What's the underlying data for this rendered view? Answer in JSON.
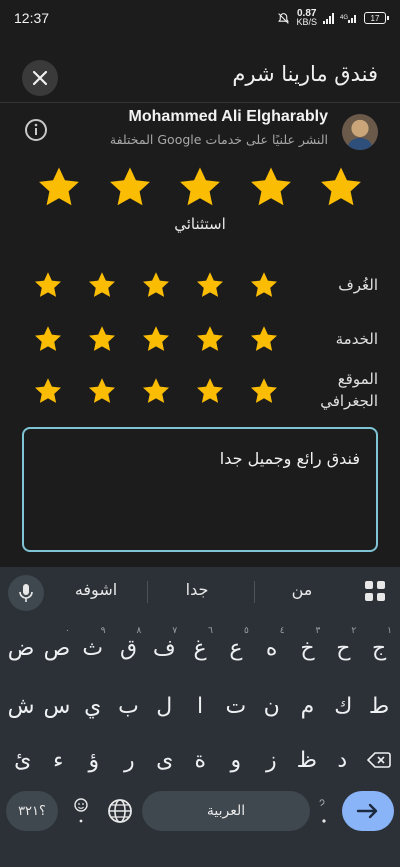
{
  "status_bar": {
    "time": "12:37",
    "net_speed_value": "0.87",
    "net_speed_unit": "KB/S",
    "battery": "17"
  },
  "header": {
    "title": "فندق مارينا شرم"
  },
  "user": {
    "name": "Mohammed Ali Elgharably",
    "subtitle": "النشر علنيًا على خدمات Google المختلفة"
  },
  "rating": {
    "overall_stars": 5,
    "overall_label": "استثنائي",
    "categories": [
      {
        "label": "الغُرف",
        "stars": 5
      },
      {
        "label": "الخدمة",
        "stars": 5
      },
      {
        "label": "الموقع الجغرافي",
        "stars": 5
      }
    ],
    "star_color": "#fbbc04"
  },
  "review": {
    "text": "فندق رائع وجميل جدا"
  },
  "keyboard": {
    "suggestions": [
      "من",
      "جدا",
      "اشوفه"
    ],
    "row1": [
      "ج",
      "ح",
      "خ",
      "ه",
      "ع",
      "غ",
      "ف",
      "ق",
      "ث",
      "ص",
      "ض"
    ],
    "row1_hints": [
      "١",
      "٢",
      "٣",
      "٤",
      "٥",
      "٦",
      "٧",
      "٨",
      "٩",
      "٠",
      ""
    ],
    "row2": [
      "ط",
      "ك",
      "م",
      "ن",
      "ت",
      "ا",
      "ل",
      "ب",
      "ي",
      "س",
      "ش"
    ],
    "row3": [
      "د",
      "ظ",
      "ز",
      "و",
      "ة",
      "ى",
      "ر",
      "ؤ",
      "ء",
      "ئ"
    ],
    "symbols_label": "؟٣٢١",
    "space_label": "العربية",
    "accent_color": "#8ab4f8"
  }
}
